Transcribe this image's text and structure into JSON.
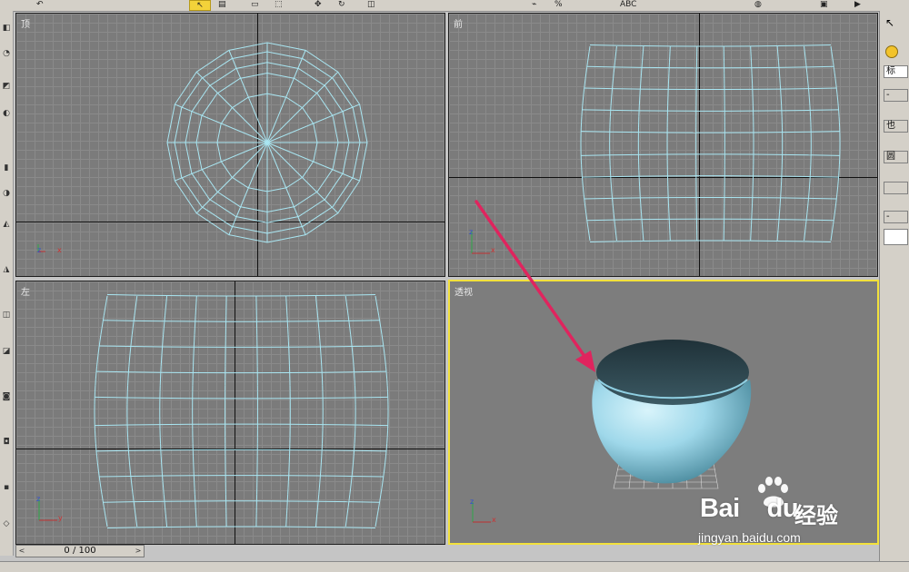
{
  "viewports": {
    "top": {
      "label": "顶"
    },
    "front": {
      "label": "前"
    },
    "left": {
      "label": "左"
    },
    "perspective": {
      "label": "透视"
    }
  },
  "axes": {
    "x": "x",
    "y": "y",
    "z": "z"
  },
  "timeline": {
    "frame_display": "0 / 100",
    "prev_glyph": "<",
    "next_glyph": ">"
  },
  "right_panel": {
    "tab_label": "标",
    "buttons": [
      "-",
      "也",
      "圆",
      "",
      "-"
    ]
  },
  "toolbar": {
    "text_tool": "ABC"
  },
  "watermark": {
    "brand": "Bai",
    "brand2": "du",
    "cn": "经验",
    "url": "jingyan.baidu.com"
  },
  "colors": {
    "wire": "#a9e6f2",
    "viewport_bg": "#7b7b7b",
    "active_border": "#f2e13c",
    "arrow": "#e0245e",
    "bowl_light": "#a9dfee",
    "bowl_dark": "#2f4750"
  }
}
